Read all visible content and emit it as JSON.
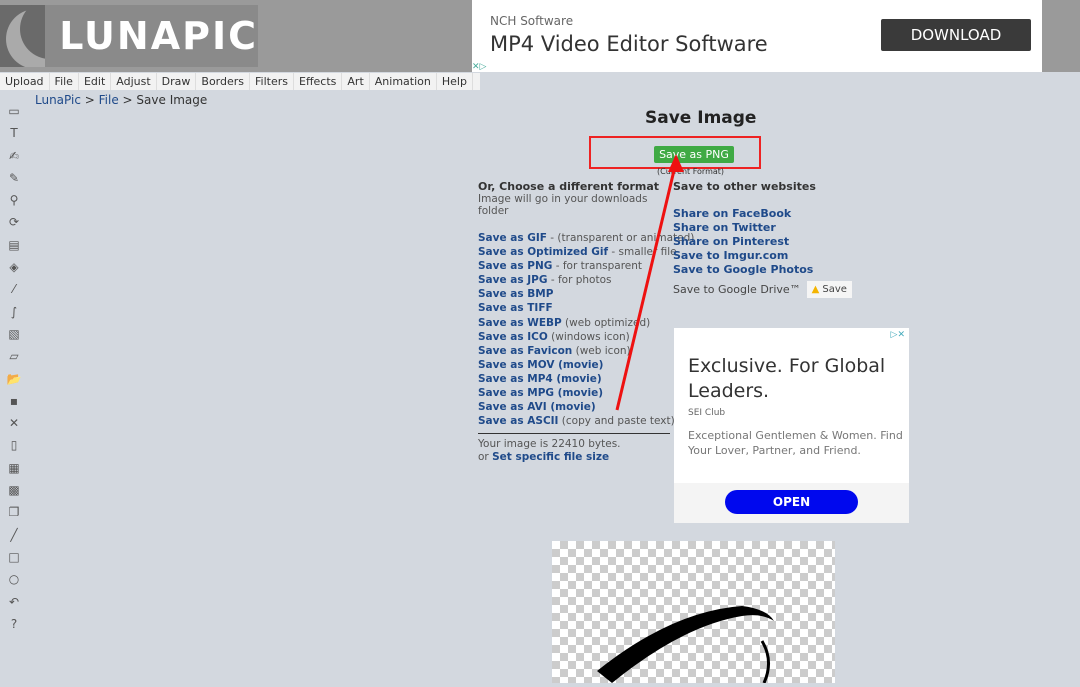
{
  "logo": "LUNAPIC",
  "top_ad": {
    "company": "NCH Software",
    "title": "MP4 Video Editor Software",
    "button": "DOWNLOAD"
  },
  "menu": [
    "Upload",
    "File",
    "Edit",
    "Adjust",
    "Draw",
    "Borders",
    "Filters",
    "Effects",
    "Art",
    "Animation",
    "Help"
  ],
  "breadcrumb": {
    "home": "LunaPic",
    "sep": " > ",
    "file": "File",
    "current": "Save Image"
  },
  "tools": [
    "select-icon",
    "text-icon",
    "signature-icon",
    "pencil-icon",
    "zoom-icon",
    "rotate-icon",
    "crop-icon",
    "fill-icon",
    "eyedropper-icon",
    "brush-icon",
    "layers-icon",
    "eraser-icon",
    "open-icon",
    "save-icon",
    "close-icon",
    "new-icon",
    "print-icon",
    "gallery-icon",
    "copy-icon",
    "line-icon",
    "rectangle-icon",
    "circle-icon",
    "undo-icon",
    "help-icon"
  ],
  "title": "Save Image",
  "primary": {
    "button": "Save as PNG",
    "note": "(Current Format)"
  },
  "formats": {
    "heading": "Or, Choose a different format",
    "sub": "Image will go in your downloads folder",
    "items": [
      {
        "link": "Save as GIF",
        "desc": " - (transparent or animated)"
      },
      {
        "link": "Save as Optimized Gif",
        "desc": " - smaller file"
      },
      {
        "link": "Save as PNG",
        "desc": " - for transparent"
      },
      {
        "link": "Save as JPG",
        "desc": " - for photos"
      },
      {
        "link": "Save as BMP",
        "desc": ""
      },
      {
        "link": "Save as TIFF",
        "desc": ""
      },
      {
        "link": "Save as WEBP",
        "desc": " (web optimized)"
      },
      {
        "link": "Save as ICO",
        "desc": " (windows icon)"
      },
      {
        "link": "Save as Favicon",
        "desc": " (web icon)"
      },
      {
        "link": "Save as MOV (movie)",
        "desc": ""
      },
      {
        "link": "Save as MP4 (movie)",
        "desc": ""
      },
      {
        "link": "Save as MPG (movie)",
        "desc": ""
      },
      {
        "link": "Save as AVI (movie)",
        "desc": ""
      },
      {
        "link": "Save as ASCII",
        "desc": " (copy and paste text)"
      }
    ],
    "size_text": "Your image is 22410 bytes.",
    "size_prefix": "or ",
    "size_link": "Set specific file size"
  },
  "websites": {
    "heading": "Save to other websites",
    "links": [
      "Share on FaceBook",
      "Share on Twitter",
      "Share on Pinterest",
      "Save to Imgur.com",
      "Save to Google Photos"
    ],
    "drive_label": "Save to Google Drive™",
    "drive_button": "Save"
  },
  "side_ad": {
    "title": "Exclusive. For Global Leaders.",
    "sponsor": "SEI Club",
    "body": "Exceptional Gentlemen & Women. Find Your Lover, Partner, and Friend.",
    "button": "OPEN"
  },
  "colors": {
    "accent_green": "#3faa44",
    "annotation_red": "#e22222",
    "link": "#1f4a8a"
  }
}
